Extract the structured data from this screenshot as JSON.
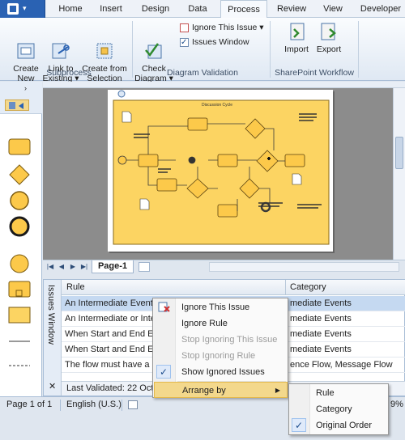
{
  "tabs": [
    {
      "label": "Home",
      "active": false
    },
    {
      "label": "Insert",
      "active": false
    },
    {
      "label": "Design",
      "active": false
    },
    {
      "label": "Data",
      "active": false
    },
    {
      "label": "Process",
      "active": true
    },
    {
      "label": "Review",
      "active": false
    },
    {
      "label": "View",
      "active": false
    },
    {
      "label": "Developer",
      "active": false
    }
  ],
  "ribbon": {
    "subprocess": {
      "label": "Subprocess",
      "create_new": "Create\nNew",
      "link_existing": "Link to\nExisting ▾",
      "create_from_selection": "Create from\nSelection"
    },
    "validation": {
      "label": "Diagram Validation",
      "check_diagram": "Check\nDiagram ▾",
      "ignore_issue": "Ignore This Issue ▾",
      "issues_window": "Issues Window",
      "issues_window_checked": true
    },
    "sharepoint": {
      "label": "SharePoint Workflow",
      "import": "Import",
      "export": "Export"
    }
  },
  "canvas": {
    "diagram_title": "Discussion Cycle",
    "page_tab": "Page-1"
  },
  "issues_window": {
    "title": "Issues Window",
    "close": "✕",
    "columns": {
      "rule": "Rule",
      "category": "Category"
    },
    "rows": [
      {
        "rule": "An Intermediate Event",
        "category": "mediate Events",
        "selected": true
      },
      {
        "rule": "An Intermediate or Inte",
        "category": "mediate Events",
        "selected": false
      },
      {
        "rule": "When Start and End Eve",
        "category": "mediate Events",
        "selected": false
      },
      {
        "rule": "When Start and End Eve",
        "category": "mediate Events",
        "selected": false
      },
      {
        "rule": "The flow must have a s",
        "category": "ence Flow, Message Flow",
        "selected": false
      }
    ],
    "last_validated": "Last Validated: 22 Octo"
  },
  "context_menu": {
    "items": [
      {
        "label": "Ignore This Issue",
        "mnemonic": "g",
        "disabled": false
      },
      {
        "label": "Ignore Rule",
        "mnemonic": "R",
        "disabled": false
      },
      {
        "label": "Stop Ignoring This Issue",
        "mnemonic": "S",
        "disabled": true
      },
      {
        "label": "Stop Ignoring Rule",
        "mnemonic": "S",
        "disabled": true
      },
      {
        "label": "Show Ignored Issues",
        "mnemonic": "S",
        "disabled": false,
        "checked": true
      },
      {
        "label": "Arrange by",
        "mnemonic": "A",
        "disabled": false,
        "submenu": true
      }
    ]
  },
  "submenu": {
    "items": [
      {
        "label": "Rule",
        "mnemonic": "R",
        "checked": false
      },
      {
        "label": "Category",
        "mnemonic": "C",
        "checked": false
      },
      {
        "label": "Original Order",
        "mnemonic": "O",
        "checked": true
      }
    ]
  },
  "status_bar": {
    "page": "Page 1 of 1",
    "language": "English (U.S.)",
    "zoom": "9%"
  },
  "colors": {
    "accent": "#2a62b3",
    "menu_highlight": "#f3d88c",
    "diagram_fill": "#fcd462"
  }
}
